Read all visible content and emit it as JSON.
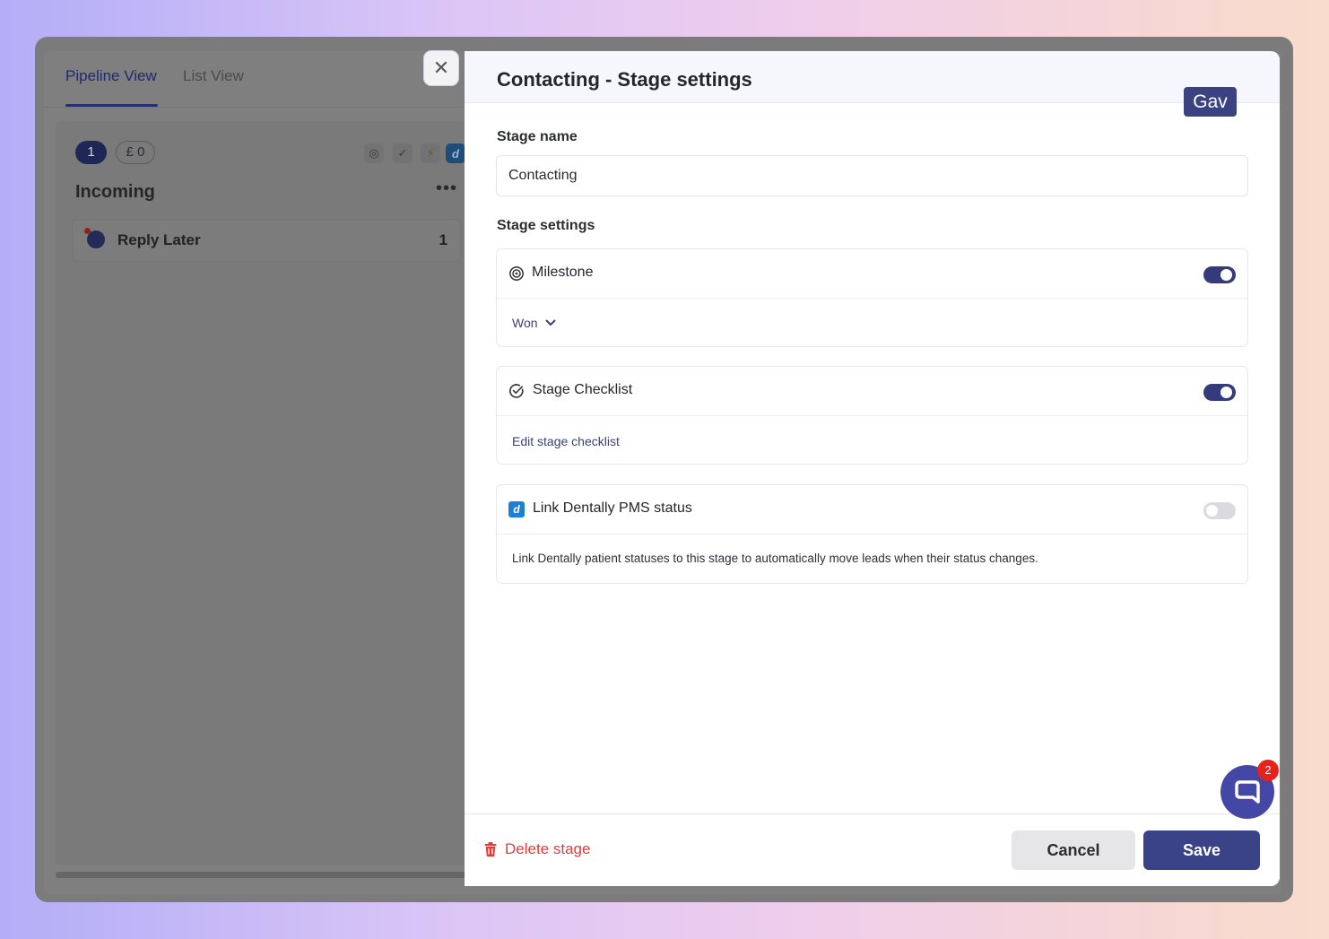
{
  "colors": {
    "accent": "#3b4388",
    "toggle_on": "#343b7d",
    "danger": "#e23b3b",
    "chat": "#4547a6",
    "badge": "#e7221c"
  },
  "background_app": {
    "tabs": [
      {
        "label": "Pipeline View",
        "active": true
      },
      {
        "label": "List View",
        "active": false
      }
    ],
    "column": {
      "count": "1",
      "amount": "£ 0",
      "title": "Incoming",
      "menu_icon": "more-dots-icon",
      "leads": [
        {
          "name": "Reply Later",
          "count": "1"
        }
      ]
    }
  },
  "panel": {
    "title": "Contacting - Stage settings",
    "user_badge": "Gav",
    "stage_name_label": "Stage name",
    "stage_name_value": "Contacting",
    "stage_settings_label": "Stage settings",
    "milestone": {
      "title": "Milestone",
      "icon": "target-icon",
      "enabled": true,
      "selected": "Won"
    },
    "checklist": {
      "title": "Stage Checklist",
      "icon": "check-circle-icon",
      "enabled": true,
      "link": "Edit stage checklist"
    },
    "dentally": {
      "title": "Link Dentally PMS status",
      "icon": "dentally-icon",
      "icon_letter": "d",
      "enabled": false,
      "description": "Link Dentally patient statuses to this stage to automatically move leads when their status changes."
    },
    "footer": {
      "delete_label": "Delete stage",
      "cancel_label": "Cancel",
      "save_label": "Save"
    }
  },
  "chat": {
    "unread_count": "2"
  }
}
